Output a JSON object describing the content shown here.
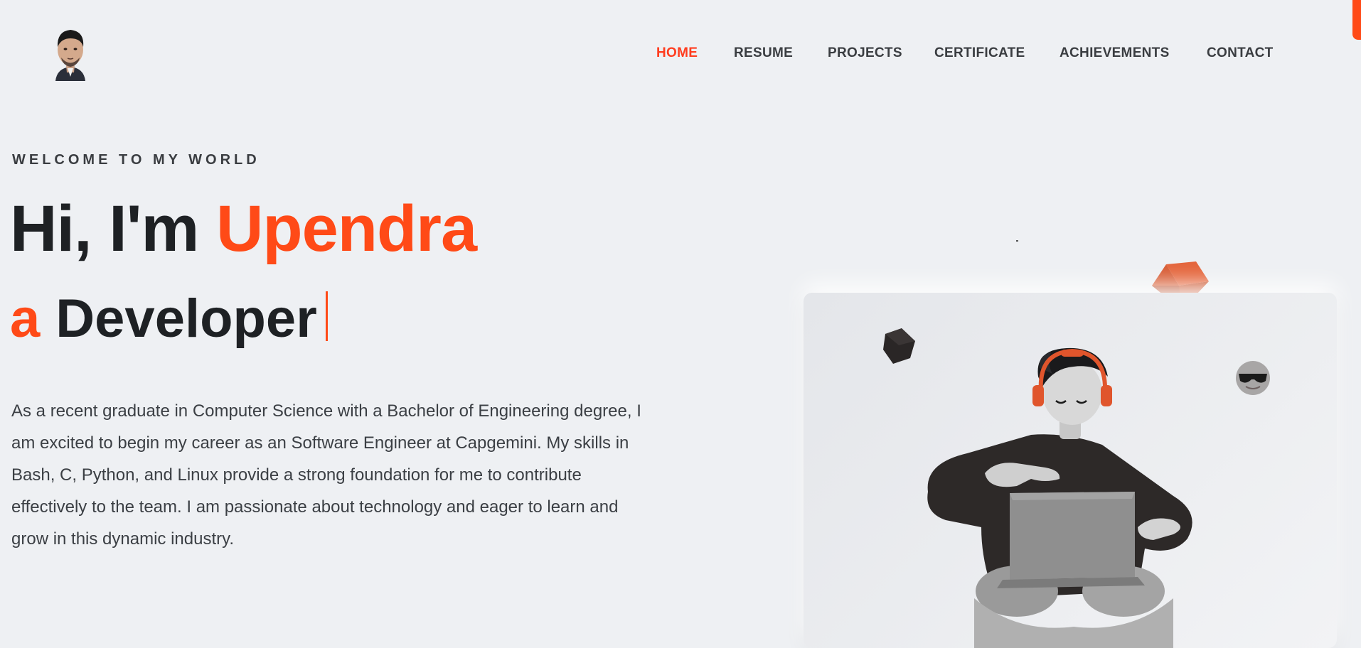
{
  "nav": {
    "items": [
      {
        "label": "HOME",
        "active": true
      },
      {
        "label": "RESUME"
      },
      {
        "label": "PROJECTS"
      },
      {
        "label": "CERTIFICATE"
      },
      {
        "label": "ACHIEVEMENTS"
      },
      {
        "label": "CONTACT"
      }
    ]
  },
  "hero": {
    "eyebrow": "WELCOME TO MY WORLD",
    "greeting": "Hi, I'm",
    "name": "Upendra",
    "role_prefix": "a",
    "role": "Developer",
    "bio": "As a recent graduate in Computer Science with a Bachelor of Engineering degree, I am excited to begin my career as an Software Engineer at Capgemini. My skills in Bash, C, Python, and Linux provide a strong foundation for me to contribute effectively to the team. I am passionate about technology and eager to learn and grow in this dynamic industry."
  },
  "colors": {
    "accent": "#ff4a17",
    "background": "#eef0f3",
    "text": "#1e2124"
  },
  "icons": {
    "avatar": "profile-photo",
    "illustration": "developer-with-laptop"
  }
}
